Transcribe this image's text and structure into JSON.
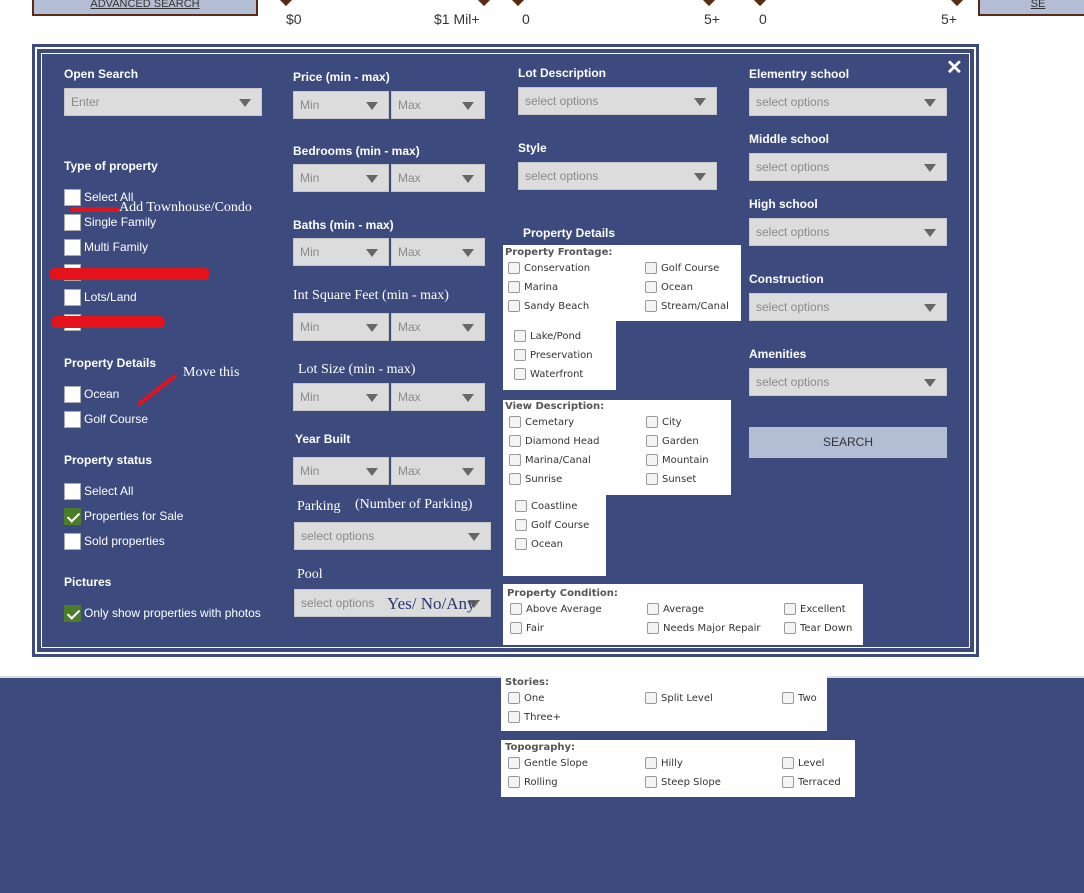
{
  "topbar": {
    "advanced_search_label": "ADVANCED SEARCH",
    "right_tab_label": "SE",
    "price_min": "$0",
    "price_max": "$1 Mil+",
    "beds_min": "0",
    "beds_max": "5+",
    "baths_min": "0",
    "baths_max": "5+"
  },
  "colors": {
    "panel_bg": "#3c4a7e",
    "select_bg": "#dcdcdc",
    "search_button_bg": "#b3bdd3",
    "checked_green": "#4a7c2a",
    "annotation_red": "#e3121b"
  },
  "close_icon": "✕",
  "open_search": {
    "label": "Open Search",
    "placeholder": "Enter"
  },
  "type_of_property": {
    "label": "Type of property",
    "items": [
      "Select All",
      "Single Family",
      "Multi Family",
      "",
      "Lots/Land",
      ""
    ]
  },
  "property_details_left": {
    "label": "Property Details",
    "items": [
      "Ocean",
      "Golf Course"
    ]
  },
  "property_status": {
    "label": "Property status",
    "items": [
      {
        "label": "Select All",
        "checked": false
      },
      {
        "label": "Properties for Sale",
        "checked": true
      },
      {
        "label": "Sold properties",
        "checked": false
      }
    ]
  },
  "pictures": {
    "label": "Pictures",
    "item": "Only show properties with photos",
    "checked": true
  },
  "ranges": {
    "min": "Min",
    "max": "Max",
    "price": "Price (min - max)",
    "bedrooms": "Bedrooms (min - max)",
    "baths": "Baths (min - max)",
    "sqft": "Int Square Feet (min - max)",
    "lot_size": "Lot Size (min - max)",
    "year_built": "Year Built"
  },
  "parking": {
    "label": "Parking",
    "note": "(Number of Parking)",
    "placeholder": "select options"
  },
  "pool": {
    "label": "Pool",
    "placeholder": "select options",
    "note": "Yes/ No/Any"
  },
  "lot_description": {
    "label": "Lot Description",
    "placeholder": "select options"
  },
  "style": {
    "label": "Style",
    "placeholder": "select options"
  },
  "property_details_mid": {
    "label": "Property Details"
  },
  "property_frontage": {
    "title": "Property Frontage:",
    "items": [
      "Conservation",
      "Golf Course",
      "Marina",
      "Ocean",
      "Sandy Beach",
      "Stream/Canal",
      "Lake/Pond",
      "Preservation",
      "Waterfront"
    ]
  },
  "view_description": {
    "title": "View Description:",
    "items": [
      "Cemetary",
      "City",
      "Diamond Head",
      "Garden",
      "Marina/Canal",
      "Mountain",
      "Sunrise",
      "Sunset",
      "Coastline",
      "Golf Course",
      "Ocean"
    ]
  },
  "property_condition": {
    "title": "Property Condition:",
    "items": [
      "Above Average",
      "Average",
      "Excellent",
      "Fair",
      "Needs Major Repair",
      "Tear Down"
    ]
  },
  "stories": {
    "title": "Stories:",
    "items": [
      "One",
      "Split Level",
      "Two",
      "Three+"
    ]
  },
  "topography": {
    "title": "Topography:",
    "items": [
      "Gentle Slope",
      "Hilly",
      "Level",
      "Rolling",
      "Steep Slope",
      "Terraced"
    ]
  },
  "schools": {
    "elementary": "Elementry school",
    "middle": "Middle school",
    "high": "High school",
    "placeholder": "select options"
  },
  "construction": {
    "label": "Construction",
    "placeholder": "select options"
  },
  "amenities": {
    "label": "Amenities",
    "placeholder": "select options"
  },
  "search_button": "SEARCH",
  "annotations": {
    "add_townhouse": "Add Townhouse/Condo",
    "move_this": "Move this"
  }
}
